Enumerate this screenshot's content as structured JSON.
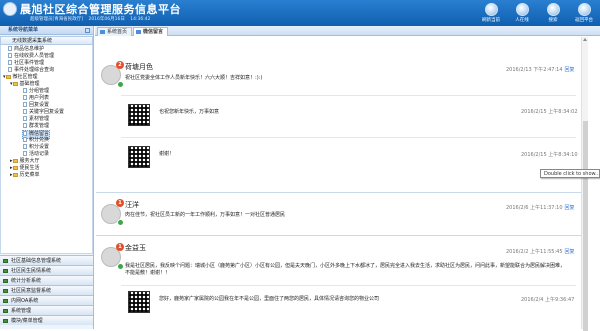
{
  "header": {
    "title": "晨旭社区综合管理服务信息平台",
    "user_info": [
      "超级管理员[青海省民政厅]",
      "2016年06月16日",
      "14:36:42"
    ],
    "buttons": [
      {
        "label": "刷新当前",
        "icon": "refresh-icon"
      },
      {
        "label": "人在线",
        "icon": "online-users-icon"
      },
      {
        "label": "搜索",
        "icon": "search-icon"
      },
      {
        "label": "返回平台",
        "icon": "return-icon"
      }
    ]
  },
  "sidebar": {
    "title": "系统导航菜单",
    "group": "无线数据采集系统",
    "tree": [
      {
        "label": "商品信息维护",
        "level": 1,
        "type": "page"
      },
      {
        "label": "在线收费人员管理",
        "level": 1,
        "type": "page"
      },
      {
        "label": "社区事件管理",
        "level": 1,
        "type": "page"
      },
      {
        "label": "事件处理综合查询",
        "level": 1,
        "type": "page"
      },
      {
        "label": "微社区管理",
        "level": 0,
        "type": "folder"
      },
      {
        "label": "基础管理",
        "level": 1,
        "type": "folder"
      },
      {
        "label": "分组管理",
        "level": 2,
        "type": "page"
      },
      {
        "label": "用户列表",
        "level": 2,
        "type": "page"
      },
      {
        "label": "回复设置",
        "level": 2,
        "type": "page"
      },
      {
        "label": "关键字回复设置",
        "level": 2,
        "type": "page"
      },
      {
        "label": "素材管理",
        "level": 2,
        "type": "page"
      },
      {
        "label": "群发管理",
        "level": 2,
        "type": "page"
      },
      {
        "label": "微信留言",
        "level": 2,
        "type": "page",
        "selected": true
      },
      {
        "label": "积分兑换",
        "level": 2,
        "type": "page"
      },
      {
        "label": "积分设置",
        "level": 2,
        "type": "page"
      },
      {
        "label": "活动记录",
        "level": 2,
        "type": "page"
      },
      {
        "label": "服务大厅",
        "level": 1,
        "type": "folder"
      },
      {
        "label": "便民生活",
        "level": 1,
        "type": "folder"
      },
      {
        "label": "历史菜单",
        "level": 1,
        "type": "folder"
      }
    ],
    "bottom_groups": [
      "社区基础信息管理系统",
      "社区民生民情系统",
      "统计分析系统",
      "社区民意监督系统",
      "内网OA系统",
      "系统管理",
      "模块/菜单管理"
    ]
  },
  "tabs": [
    {
      "label": "系统首页",
      "active": false
    },
    {
      "label": "微信留言",
      "active": true
    }
  ],
  "messages": [
    {
      "user": "荷塘月色",
      "badge": "2",
      "text": "祝社区党委全体工作人员新年快乐！六六大顺！吉祥如意！:):)",
      "time": "2016/2/13 下午2:47:14",
      "reply_label": "回复",
      "replies": [
        {
          "text": "也祝您新年快乐，万事如意",
          "time": "2016/2/15 上午8:34:02"
        },
        {
          "text": "谢谢！",
          "time": "2016/2/15 上午8:34:10"
        }
      ]
    },
    {
      "user": "汪洋",
      "badge": "1",
      "text": "肉在佳节，祝社区员工新的一年工作顺利，万事如意！一对社区普通居民",
      "time": "2016/2/6 上午11:37:10",
      "reply_label": "回复"
    },
    {
      "user": "金益玉",
      "badge": "1",
      "text": "我是社区居民，我反映个问题：瑞城小区（鹿苑第广小区）小区有公园，但是夫天晚门，小区外多晚上下水都冰了，居民完全进入我去生活，求助社区为居民，问问此事，新望能联合为居民解决困难，不能是敷！谢谢！！",
      "time": "2016/2/2 上午11:55:45",
      "reply_label": "回复",
      "replies": [
        {
          "text": "您好，鹿苑家广家属院的公园我在年不是公园，里面住了两您的居民，具体情况请咨询您的物业公司",
          "time": "2016/2/4 上午9:36:47"
        }
      ]
    }
  ],
  "tooltip": "Double click to show..."
}
